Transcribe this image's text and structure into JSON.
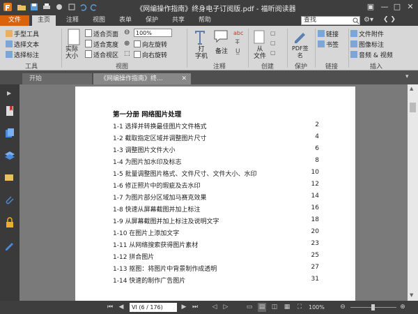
{
  "window": {
    "title": "《网编操作指南》终身电子订阅版.pdf - 福昕阅读器"
  },
  "menu": {
    "file_tab": "文件",
    "tabs": [
      "主页",
      "注释",
      "视图",
      "表单",
      "保护",
      "共享",
      "帮助"
    ],
    "search_placeholder": "查找"
  },
  "ribbon": {
    "tools": {
      "hand": "手型工具",
      "select_text": "选择文本",
      "select_note": "选择标注",
      "group": "工具"
    },
    "actual_size": "实际\n大小",
    "view": {
      "fit_page": "适合页面",
      "fit_width": "适合宽度",
      "fit_visible": "适合视区",
      "zoom_value": "100%",
      "rotate_left": "向左旋转",
      "rotate_right": "向右旋转",
      "group": "视图"
    },
    "annot": {
      "typewriter": "打\n字机",
      "note": "备注",
      "group": "注释"
    },
    "create": {
      "from_file": "从\n文件",
      "group": "创建"
    },
    "protect": {
      "pdf_sign": "PDF签\n名",
      "group": "保护"
    },
    "links": {
      "link": "链接",
      "bookmark": "书签",
      "group": "链接"
    },
    "insert": {
      "attachment": "文件附件",
      "image_mark": "图像标注",
      "audio_video": "音频 & 视频",
      "group": "插入"
    }
  },
  "doctabs": [
    "开始",
    "《网编操作指南》终..."
  ],
  "toc": {
    "title": "第一分册  网络图片处理",
    "entries": [
      {
        "text": "1-1 选择并转换最佳图片文件格式",
        "page": "2"
      },
      {
        "text": "1-2 截取指定区域并调整图片尺寸",
        "page": "4"
      },
      {
        "text": "1-3 调整图片文件大小",
        "page": "6"
      },
      {
        "text": "1-4 为图片加水印及标志",
        "page": "8"
      },
      {
        "text": "1-5 批量调整图片格式、文件尺寸、文件大小、水印",
        "page": "10"
      },
      {
        "text": "1-6 修正照片中的瑕疵及去水印",
        "page": "12"
      },
      {
        "text": "1-7 为图片部分区域加马赛克效果",
        "page": "14"
      },
      {
        "text": "1-8 快速从屏幕截图并加上标注",
        "page": "16"
      },
      {
        "text": "1-9 从屏幕截图并加上标注及说明文字",
        "page": "18"
      },
      {
        "text": "1-10 在图片上添加文字",
        "page": "20"
      },
      {
        "text": "1-11 从网络搜索获得图片素材",
        "page": "23"
      },
      {
        "text": "1-12 拼合图片",
        "page": "25"
      },
      {
        "text": "1-13 抠图：将图片中背景制作成透明",
        "page": "27"
      },
      {
        "text": "1-14 快速的制作广告图片",
        "page": "31"
      }
    ]
  },
  "status": {
    "page_indicator": "VI  (6 / 176)",
    "zoom": "100%"
  },
  "colors": {
    "accent": "#d9620a",
    "chrome": "#3e3e3e",
    "ribbon": "#d7d7d7"
  }
}
